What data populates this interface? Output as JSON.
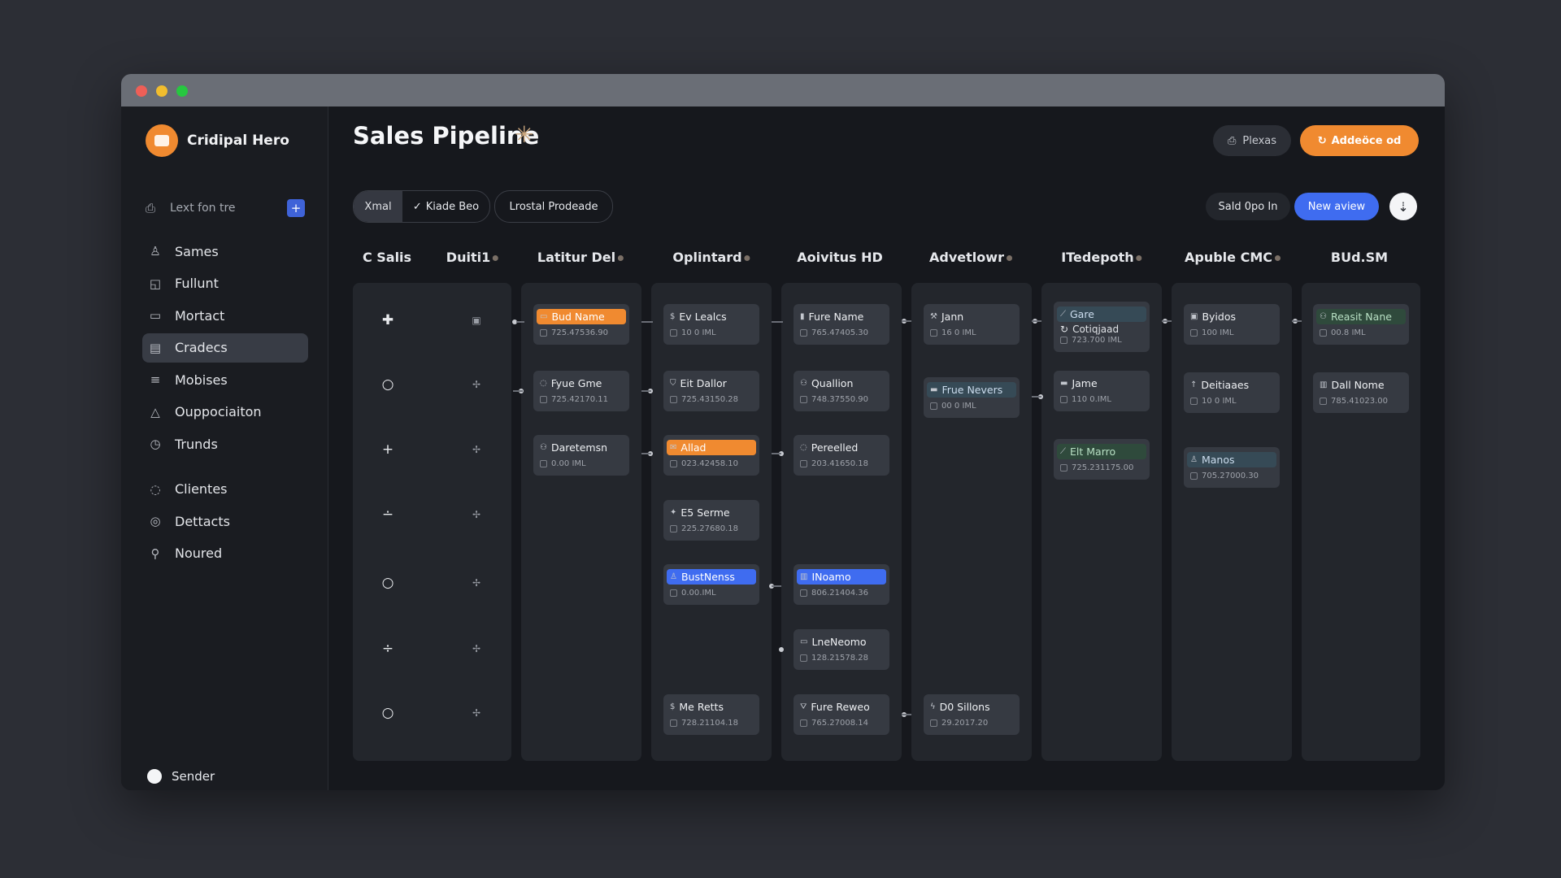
{
  "app": {
    "name": "Cridipal Hero"
  },
  "sidebar": {
    "search_text": "Lext fon tre",
    "items": [
      {
        "label": "Sames",
        "icon": "person-icon"
      },
      {
        "label": "Fullunt",
        "icon": "bag-icon"
      },
      {
        "label": "Mortact",
        "icon": "folder-icon"
      },
      {
        "label": "Cradecs",
        "icon": "document-icon",
        "active": true
      },
      {
        "label": "Mobises",
        "icon": "list-icon"
      },
      {
        "label": "Ouppociaiton",
        "icon": "bell-icon"
      },
      {
        "label": "Trunds",
        "icon": "clock-icon"
      },
      {
        "label": "Clientes",
        "icon": "chat-icon"
      },
      {
        "label": "Dettacts",
        "icon": "target-icon"
      },
      {
        "label": "Noured",
        "icon": "search-icon"
      }
    ],
    "user": "Sender"
  },
  "header": {
    "title": "Sales Pipeline",
    "pipes_label": "Plexas",
    "add_label": "Addeöce od"
  },
  "toolbar": {
    "filter_a": "Xmal",
    "filter_b": "Kiade Beo",
    "filter_c": "Lrostal Prodeade",
    "sold_label": "Sald 0po In",
    "new_view_label": "New aview"
  },
  "columns": [
    "C Salis",
    "Duiti1",
    "Latitur Del",
    "Oplintard",
    "Aoivitus HD",
    "Advetlowr",
    "ITedepoth",
    "Apuble CMC",
    "BUd.SM"
  ],
  "stages": [
    {
      "cards": [
        {
          "title": "Bud Name",
          "sub": "725.47536.90",
          "accent": "orange"
        },
        {
          "title": "Fyue Gme",
          "sub": "725.42170.11"
        },
        {
          "title": "Daretemsn",
          "sub": "0.00 IML"
        }
      ]
    },
    {
      "cards": [
        {
          "title": "Ev Lealcs",
          "sub": "10 0 IML"
        },
        {
          "title": "Eit Dallor",
          "sub": "725.43150.28"
        },
        {
          "title": "Allad",
          "sub": "023.42458.10",
          "accent": "orange"
        },
        {
          "title": "E5 Serme",
          "sub": "225.27680.18"
        },
        {
          "title": "BustNenss",
          "sub": "0.00.IML",
          "accent": "blue"
        },
        {
          "title": "Me Retts",
          "sub": "728.21104.18"
        }
      ]
    },
    {
      "cards": [
        {
          "title": "Fure Name",
          "sub": "765.47405.30"
        },
        {
          "title": "Quallion",
          "sub": "748.37550.90"
        },
        {
          "title": "Pereelled",
          "sub": "203.41650.18"
        },
        {
          "title": "INoamo",
          "sub": "806.21404.36",
          "accent": "blue"
        },
        {
          "title": "LneNeomo",
          "sub": "128.21578.28"
        },
        {
          "title": "Fure Reweo",
          "sub": "765.27008.14"
        }
      ]
    },
    {
      "cards": [
        {
          "title": "Jann",
          "sub": "16 0 IML"
        },
        {
          "title": "Frue Nevers",
          "sub": "00 0 IML",
          "accent": "teal"
        },
        {
          "title": "D0 Sillons",
          "sub": "29.2017.20"
        }
      ]
    },
    {
      "cards": [
        {
          "title": "Gare",
          "extra": "Cotiqjaad",
          "sub": "723.700 IML",
          "accent": "teal"
        },
        {
          "title": "Jame",
          "sub": "110 0.IML"
        },
        {
          "title": "Elt Marro",
          "sub": "725.231175.00",
          "accent": "green"
        }
      ]
    },
    {
      "cards": [
        {
          "title": "Byidos",
          "sub": "100 IML"
        },
        {
          "title": "Deitiaaes",
          "sub": "10 0 IML"
        },
        {
          "title": "Manos",
          "sub": "705.27000.30",
          "accent": "teal"
        }
      ]
    },
    {
      "cards": [
        {
          "title": "Reasit Nane",
          "sub": "00.8 IML",
          "accent": "green"
        },
        {
          "title": "Dall Nome",
          "sub": "785.41023.00"
        }
      ]
    }
  ]
}
